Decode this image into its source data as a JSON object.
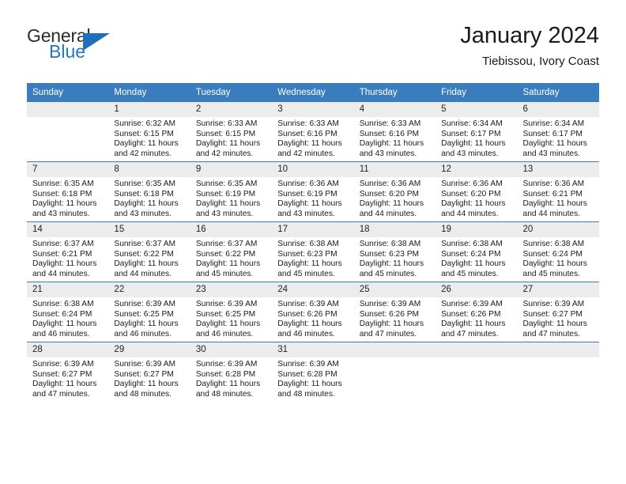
{
  "brand": {
    "line1": "General",
    "line2": "Blue",
    "triangle_color": "#1f6fba"
  },
  "header": {
    "title": "January 2024",
    "subtitle": "Tiebissou, Ivory Coast"
  },
  "theme": {
    "header_blue": "#3a7dbf",
    "daynum_band": "#ececec",
    "text": "#1a1a1a"
  },
  "labels": {
    "sunrise_prefix": "Sunrise: ",
    "sunset_prefix": "Sunset: ",
    "daylight_prefix": "Daylight: "
  },
  "weekdays": [
    "Sunday",
    "Monday",
    "Tuesday",
    "Wednesday",
    "Thursday",
    "Friday",
    "Saturday"
  ],
  "weeks": [
    [
      {
        "day": "",
        "blank": true
      },
      {
        "day": "1",
        "sunrise": "Sunrise: 6:32 AM",
        "sunset": "Sunset: 6:15 PM",
        "daylight1": "Daylight: 11 hours",
        "daylight2": "and 42 minutes."
      },
      {
        "day": "2",
        "sunrise": "Sunrise: 6:33 AM",
        "sunset": "Sunset: 6:15 PM",
        "daylight1": "Daylight: 11 hours",
        "daylight2": "and 42 minutes."
      },
      {
        "day": "3",
        "sunrise": "Sunrise: 6:33 AM",
        "sunset": "Sunset: 6:16 PM",
        "daylight1": "Daylight: 11 hours",
        "daylight2": "and 42 minutes."
      },
      {
        "day": "4",
        "sunrise": "Sunrise: 6:33 AM",
        "sunset": "Sunset: 6:16 PM",
        "daylight1": "Daylight: 11 hours",
        "daylight2": "and 43 minutes."
      },
      {
        "day": "5",
        "sunrise": "Sunrise: 6:34 AM",
        "sunset": "Sunset: 6:17 PM",
        "daylight1": "Daylight: 11 hours",
        "daylight2": "and 43 minutes."
      },
      {
        "day": "6",
        "sunrise": "Sunrise: 6:34 AM",
        "sunset": "Sunset: 6:17 PM",
        "daylight1": "Daylight: 11 hours",
        "daylight2": "and 43 minutes."
      }
    ],
    [
      {
        "day": "7",
        "sunrise": "Sunrise: 6:35 AM",
        "sunset": "Sunset: 6:18 PM",
        "daylight1": "Daylight: 11 hours",
        "daylight2": "and 43 minutes."
      },
      {
        "day": "8",
        "sunrise": "Sunrise: 6:35 AM",
        "sunset": "Sunset: 6:18 PM",
        "daylight1": "Daylight: 11 hours",
        "daylight2": "and 43 minutes."
      },
      {
        "day": "9",
        "sunrise": "Sunrise: 6:35 AM",
        "sunset": "Sunset: 6:19 PM",
        "daylight1": "Daylight: 11 hours",
        "daylight2": "and 43 minutes."
      },
      {
        "day": "10",
        "sunrise": "Sunrise: 6:36 AM",
        "sunset": "Sunset: 6:19 PM",
        "daylight1": "Daylight: 11 hours",
        "daylight2": "and 43 minutes."
      },
      {
        "day": "11",
        "sunrise": "Sunrise: 6:36 AM",
        "sunset": "Sunset: 6:20 PM",
        "daylight1": "Daylight: 11 hours",
        "daylight2": "and 44 minutes."
      },
      {
        "day": "12",
        "sunrise": "Sunrise: 6:36 AM",
        "sunset": "Sunset: 6:20 PM",
        "daylight1": "Daylight: 11 hours",
        "daylight2": "and 44 minutes."
      },
      {
        "day": "13",
        "sunrise": "Sunrise: 6:36 AM",
        "sunset": "Sunset: 6:21 PM",
        "daylight1": "Daylight: 11 hours",
        "daylight2": "and 44 minutes."
      }
    ],
    [
      {
        "day": "14",
        "sunrise": "Sunrise: 6:37 AM",
        "sunset": "Sunset: 6:21 PM",
        "daylight1": "Daylight: 11 hours",
        "daylight2": "and 44 minutes."
      },
      {
        "day": "15",
        "sunrise": "Sunrise: 6:37 AM",
        "sunset": "Sunset: 6:22 PM",
        "daylight1": "Daylight: 11 hours",
        "daylight2": "and 44 minutes."
      },
      {
        "day": "16",
        "sunrise": "Sunrise: 6:37 AM",
        "sunset": "Sunset: 6:22 PM",
        "daylight1": "Daylight: 11 hours",
        "daylight2": "and 45 minutes."
      },
      {
        "day": "17",
        "sunrise": "Sunrise: 6:38 AM",
        "sunset": "Sunset: 6:23 PM",
        "daylight1": "Daylight: 11 hours",
        "daylight2": "and 45 minutes."
      },
      {
        "day": "18",
        "sunrise": "Sunrise: 6:38 AM",
        "sunset": "Sunset: 6:23 PM",
        "daylight1": "Daylight: 11 hours",
        "daylight2": "and 45 minutes."
      },
      {
        "day": "19",
        "sunrise": "Sunrise: 6:38 AM",
        "sunset": "Sunset: 6:24 PM",
        "daylight1": "Daylight: 11 hours",
        "daylight2": "and 45 minutes."
      },
      {
        "day": "20",
        "sunrise": "Sunrise: 6:38 AM",
        "sunset": "Sunset: 6:24 PM",
        "daylight1": "Daylight: 11 hours",
        "daylight2": "and 45 minutes."
      }
    ],
    [
      {
        "day": "21",
        "sunrise": "Sunrise: 6:38 AM",
        "sunset": "Sunset: 6:24 PM",
        "daylight1": "Daylight: 11 hours",
        "daylight2": "and 46 minutes."
      },
      {
        "day": "22",
        "sunrise": "Sunrise: 6:39 AM",
        "sunset": "Sunset: 6:25 PM",
        "daylight1": "Daylight: 11 hours",
        "daylight2": "and 46 minutes."
      },
      {
        "day": "23",
        "sunrise": "Sunrise: 6:39 AM",
        "sunset": "Sunset: 6:25 PM",
        "daylight1": "Daylight: 11 hours",
        "daylight2": "and 46 minutes."
      },
      {
        "day": "24",
        "sunrise": "Sunrise: 6:39 AM",
        "sunset": "Sunset: 6:26 PM",
        "daylight1": "Daylight: 11 hours",
        "daylight2": "and 46 minutes."
      },
      {
        "day": "25",
        "sunrise": "Sunrise: 6:39 AM",
        "sunset": "Sunset: 6:26 PM",
        "daylight1": "Daylight: 11 hours",
        "daylight2": "and 47 minutes."
      },
      {
        "day": "26",
        "sunrise": "Sunrise: 6:39 AM",
        "sunset": "Sunset: 6:26 PM",
        "daylight1": "Daylight: 11 hours",
        "daylight2": "and 47 minutes."
      },
      {
        "day": "27",
        "sunrise": "Sunrise: 6:39 AM",
        "sunset": "Sunset: 6:27 PM",
        "daylight1": "Daylight: 11 hours",
        "daylight2": "and 47 minutes."
      }
    ],
    [
      {
        "day": "28",
        "sunrise": "Sunrise: 6:39 AM",
        "sunset": "Sunset: 6:27 PM",
        "daylight1": "Daylight: 11 hours",
        "daylight2": "and 47 minutes."
      },
      {
        "day": "29",
        "sunrise": "Sunrise: 6:39 AM",
        "sunset": "Sunset: 6:27 PM",
        "daylight1": "Daylight: 11 hours",
        "daylight2": "and 48 minutes."
      },
      {
        "day": "30",
        "sunrise": "Sunrise: 6:39 AM",
        "sunset": "Sunset: 6:28 PM",
        "daylight1": "Daylight: 11 hours",
        "daylight2": "and 48 minutes."
      },
      {
        "day": "31",
        "sunrise": "Sunrise: 6:39 AM",
        "sunset": "Sunset: 6:28 PM",
        "daylight1": "Daylight: 11 hours",
        "daylight2": "and 48 minutes."
      },
      {
        "day": "",
        "blank": true
      },
      {
        "day": "",
        "blank": true
      },
      {
        "day": "",
        "blank": true
      }
    ]
  ]
}
